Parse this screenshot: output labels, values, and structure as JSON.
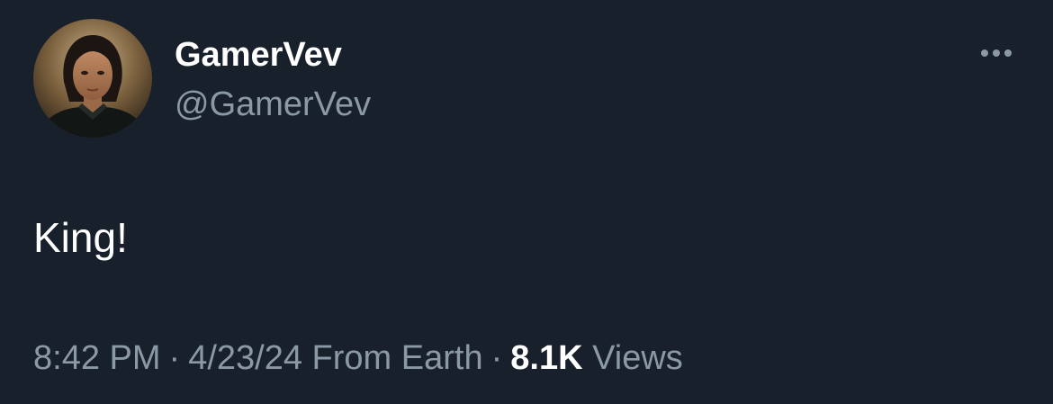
{
  "tweet": {
    "author": {
      "display_name": "GamerVev",
      "handle": "@GamerVev",
      "avatar_icon": "profile-photo"
    },
    "more_icon": "more-options-icon",
    "text": "King!",
    "meta": {
      "time": "8:42 PM",
      "separator": "·",
      "date": "4/23/24",
      "source": "From Earth",
      "views_count": "8.1K",
      "views_label": "Views"
    }
  },
  "colors": {
    "background": "#18202b",
    "primary_text": "#ffffff",
    "secondary_text": "#8b98a5"
  }
}
